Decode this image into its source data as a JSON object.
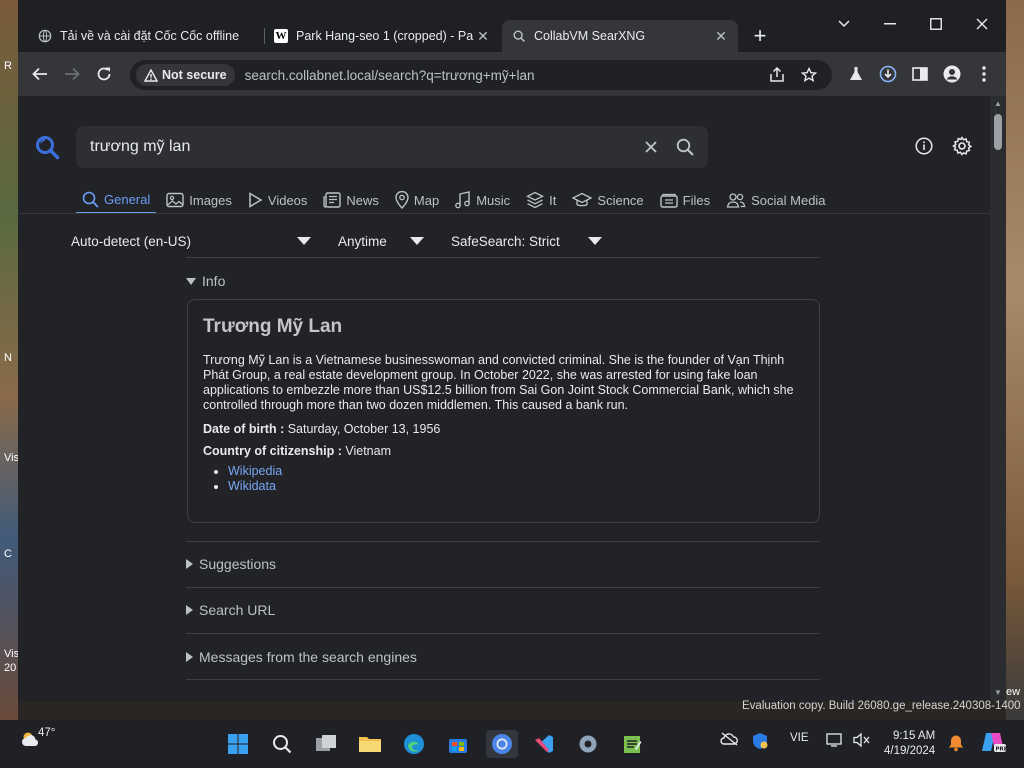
{
  "browser": {
    "tabs": [
      {
        "title": "Tải về và cài đặt Cốc Cốc offline",
        "active": false,
        "favicon": "globe-icon"
      },
      {
        "title": "Park Hang-seo 1 (cropped) - Pa",
        "active": false,
        "favicon": "wikipedia-icon"
      },
      {
        "title": "CollabVM SearXNG",
        "active": true,
        "favicon": "searxng-icon"
      }
    ],
    "security_badge": "Not secure",
    "url": "search.collabnet.local/search?q=trương+mỹ+lan"
  },
  "search": {
    "query": "trương mỹ lan",
    "categories": [
      {
        "label": "General",
        "icon": "search-icon",
        "active": true
      },
      {
        "label": "Images",
        "icon": "image-icon"
      },
      {
        "label": "Videos",
        "icon": "play-icon"
      },
      {
        "label": "News",
        "icon": "newspaper-icon"
      },
      {
        "label": "Map",
        "icon": "map-pin-icon"
      },
      {
        "label": "Music",
        "icon": "music-icon"
      },
      {
        "label": "It",
        "icon": "layers-icon"
      },
      {
        "label": "Science",
        "icon": "graduation-cap-icon"
      },
      {
        "label": "Files",
        "icon": "files-icon"
      },
      {
        "label": "Social Media",
        "icon": "people-icon"
      }
    ],
    "filters": {
      "language": "Auto-detect (en-US)",
      "time": "Anytime",
      "safesearch": "SafeSearch: Strict"
    }
  },
  "infobox": {
    "section_label": "Info",
    "title": "Trương Mỹ Lan",
    "description": "Trương Mỹ Lan is a Vietnamese businesswoman and convicted criminal. She is the founder of Vạn Thịnh Phát Group, a real estate development group. In October 2022, she was arrested for using fake loan applications to embezzle more than US$12.5 billion from Sai Gon Joint Stock Commercial Bank, which she controlled through more than two dozen middlemen. This caused a bank run.",
    "dob_label": "Date of birth : ",
    "dob_value": "Saturday, October 13, 1956",
    "country_label": "Country of citizenship : ",
    "country_value": "Vietnam",
    "links": [
      "Wikipedia",
      "Wikidata"
    ]
  },
  "sections": {
    "suggestions": "Suggestions",
    "search_url": "Search URL",
    "messages": "Messages from the search engines"
  },
  "desktop": {
    "watermark": "Evaluation copy. Build 26080.ge_release.240308-1400",
    "left_fragments": [
      "R",
      "N",
      "Vis",
      "C",
      "Vis",
      "20"
    ],
    "right_fragment": "ew"
  },
  "taskbar": {
    "weather_temp": "47°",
    "language": "VIE",
    "time": "9:15 AM",
    "date": "4/19/2024"
  }
}
